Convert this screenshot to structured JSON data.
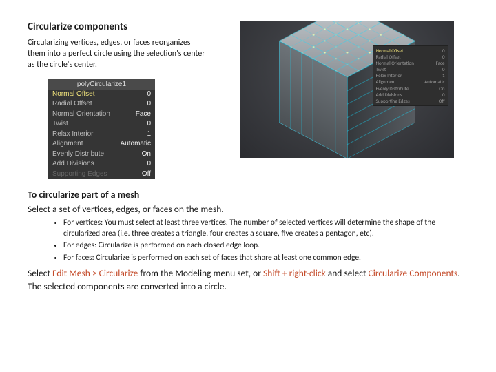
{
  "title": "Circularize components",
  "intro": "Circularizing vertices, edges, or faces reorganizes them into a perfect circle using the selection's center as the circle's center.",
  "panel": {
    "title": "polyCircularize1",
    "rows": [
      {
        "k": "Normal Offset",
        "v": "0",
        "hl": true
      },
      {
        "k": "Radial Offset",
        "v": "0"
      },
      {
        "k": "Normal Orientation",
        "v": "Face"
      },
      {
        "k": "Twist",
        "v": "0"
      },
      {
        "k": "Relax Interior",
        "v": "1"
      },
      {
        "k": "Alignment",
        "v": "Automatic"
      },
      {
        "k": "Evenly Distribute",
        "v": "On"
      },
      {
        "k": "Add Divisions",
        "v": "0"
      },
      {
        "k": "Supporting Edges",
        "v": "Off",
        "faded": true
      }
    ]
  },
  "subtitle": "To circularize part of a mesh",
  "step_select": "Select a set of vertices, edges, or faces on the mesh.",
  "bullets": [
    "For vertices: You must select at least three vertices. The number of selected vertices will determine the shape of the circularized area (i.e. three creates a triangle, four creates a square, five creates a pentagon, etc).",
    "For edges: Circularize is performed on each closed edge loop.",
    "For faces: Circularize is performed on each set of faces that share at least one common edge."
  ],
  "cmd": {
    "pre": "Select ",
    "menu": "Edit Mesh > Circularize",
    "mid": " from the Modeling menu set, or ",
    "shortcut": "Shift + right-click",
    "mid2": " and select ",
    "item": "Circularize Components",
    "end": "."
  },
  "result": "The selected components are converted into a circle."
}
